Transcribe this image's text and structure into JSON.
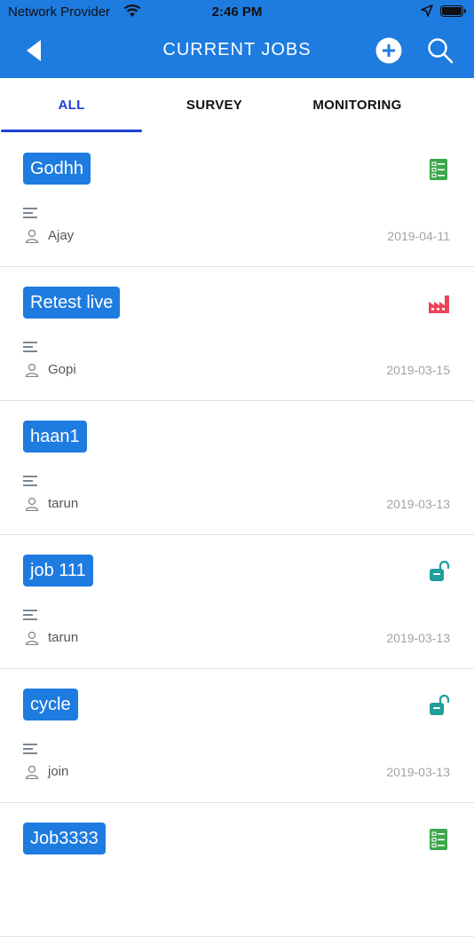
{
  "status_bar": {
    "carrier": "Network Provider",
    "time": "2:46 PM"
  },
  "nav": {
    "title": "CURRENT JOBS"
  },
  "tabs": [
    {
      "label": "ALL",
      "active": true
    },
    {
      "label": "SURVEY",
      "active": false
    },
    {
      "label": "MONITORING",
      "active": false
    }
  ],
  "jobs": [
    {
      "name": "Godhh",
      "user": "Ajay",
      "date": "2019-04-11",
      "icon": "checklist-icon"
    },
    {
      "name": "Retest live",
      "user": "Gopi",
      "date": "2019-03-15",
      "icon": "factory-icon"
    },
    {
      "name": "haan1",
      "user": "tarun",
      "date": "2019-03-13",
      "icon": ""
    },
    {
      "name": "job 111",
      "user": "tarun",
      "date": "2019-03-13",
      "icon": "unlocked-icon"
    },
    {
      "name": "cycle",
      "user": "join",
      "date": "2019-03-13",
      "icon": "unlocked-icon"
    },
    {
      "name": "Job3333",
      "user": "",
      "date": "",
      "icon": "checklist-icon"
    }
  ],
  "colors": {
    "primary": "#1e7be0",
    "tab_active": "#1e3fd8",
    "checklist": "#3aa84a",
    "factory": "#e8455a",
    "lock": "#1f9e9a"
  }
}
